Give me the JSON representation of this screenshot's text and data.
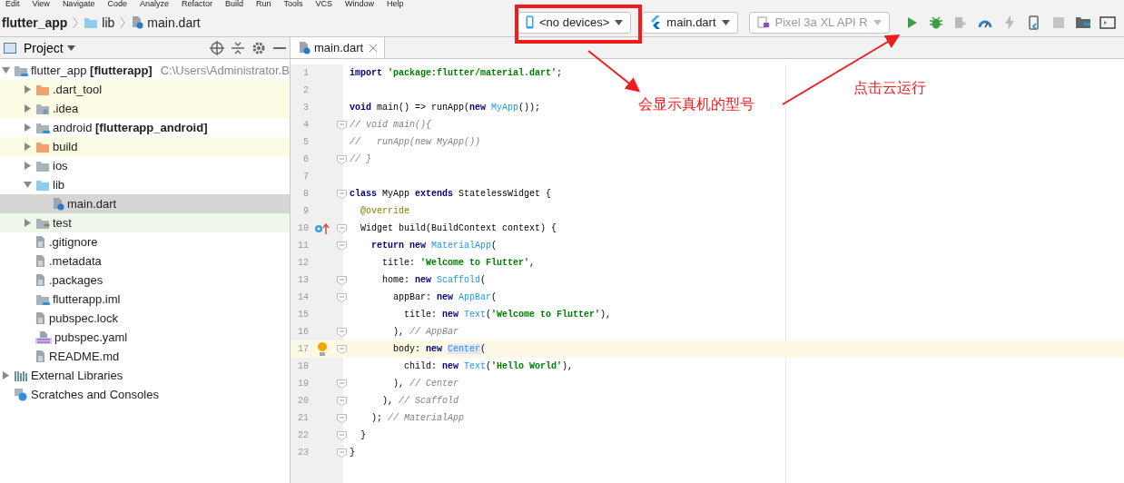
{
  "menu": [
    "Edit",
    "View",
    "Navigate",
    "Code",
    "Analyze",
    "Refactor",
    "Build",
    "Run",
    "Tools",
    "VCS",
    "Window",
    "Help"
  ],
  "breadcrumbs": [
    {
      "label": "flutter_app",
      "kind": "project"
    },
    {
      "label": "lib",
      "kind": "folder"
    },
    {
      "label": "main.dart",
      "kind": "dart"
    }
  ],
  "device_selector": {
    "label": "<no devices>"
  },
  "run_config": {
    "label": "main.dart"
  },
  "emulator_selector": {
    "label": "Pixel 3a XL API R",
    "disabled": true
  },
  "toolbar_icons": [
    {
      "kind": "run",
      "disabled": false
    },
    {
      "kind": "debug",
      "disabled": false
    },
    {
      "kind": "attach",
      "disabled": true
    },
    {
      "kind": "profile",
      "disabled": false
    },
    {
      "kind": "reload",
      "disabled": true
    },
    {
      "kind": "device",
      "disabled": false
    },
    {
      "kind": "stop",
      "disabled": true
    },
    {
      "kind": "structure",
      "disabled": false
    },
    {
      "kind": "terminal",
      "disabled": false
    }
  ],
  "project_panel": {
    "title": "Project",
    "tree": [
      {
        "label": "flutter_app **[flutterapp]**",
        "path": "C:\\Users\\Administrator.B",
        "kind": "module",
        "expanded": true,
        "selected": false,
        "children": [
          {
            "label": ".dart_tool",
            "kind": "folder-orange",
            "expanded": false,
            "selected": false,
            "excluded": true,
            "test": false
          },
          {
            "label": ".idea",
            "kind": "folder-gear",
            "expanded": false,
            "selected": false,
            "excluded": true,
            "test": false
          },
          {
            "label": "android **[flutterapp_android]**",
            "kind": "module",
            "expanded": false,
            "selected": false,
            "excluded": false,
            "test": false
          },
          {
            "label": "build",
            "kind": "folder-orange",
            "expanded": false,
            "selected": false,
            "excluded": true,
            "test": false
          },
          {
            "label": "ios",
            "kind": "folder-gray",
            "expanded": false,
            "selected": false,
            "excluded": false,
            "test": false
          },
          {
            "label": "lib",
            "kind": "folder",
            "expanded": true,
            "selected": false,
            "excluded": false,
            "test": false,
            "children": [
              {
                "label": "main.dart",
                "kind": "dart",
                "selected": true
              }
            ]
          },
          {
            "label": "test",
            "kind": "folder-test",
            "expanded": false,
            "selected": false,
            "excluded": false,
            "test": true
          },
          {
            "label": ".gitignore",
            "kind": "file",
            "selected": false,
            "excluded": false,
            "test": false
          },
          {
            "label": ".metadata",
            "kind": "file",
            "selected": false,
            "excluded": false,
            "test": false
          },
          {
            "label": ".packages",
            "kind": "file",
            "selected": false,
            "excluded": false,
            "test": false
          },
          {
            "label": "flutterapp.iml",
            "kind": "module",
            "selected": false,
            "excluded": false,
            "test": false
          },
          {
            "label": "pubspec.lock",
            "kind": "file",
            "selected": false,
            "excluded": false,
            "test": false
          },
          {
            "label": "pubspec.yaml",
            "kind": "yaml",
            "selected": false,
            "excluded": false,
            "test": false
          },
          {
            "label": "README.md",
            "kind": "file",
            "selected": false,
            "excluded": false,
            "test": false
          }
        ]
      },
      {
        "label": "External Libraries",
        "kind": "libraries",
        "expanded": false,
        "selected": false
      },
      {
        "label": "Scratches and Consoles",
        "kind": "scratches",
        "selected": false
      }
    ]
  },
  "editor": {
    "tabs": [
      {
        "label": "main.dart",
        "selected": true
      }
    ],
    "lines": [
      {
        "number": "1",
        "kind": "plain",
        "fold": false,
        "current": false,
        "tokens": [
          {
            "kind": "kw",
            "text": "import"
          },
          {
            "kind": "str",
            "text": " 'package:flutter/material.dart'"
          },
          {
            "kind": "plain",
            "text": ";"
          }
        ]
      },
      {
        "number": "2",
        "kind": "plain",
        "fold": false,
        "current": false
      },
      {
        "number": "3",
        "kind": "plain",
        "fold": false,
        "current": false,
        "tokens": [
          {
            "kind": "kw",
            "text": "void"
          },
          {
            "kind": "plain",
            "text": " main() => runApp("
          },
          {
            "kind": "kw",
            "text": "new "
          },
          {
            "kind": "cls",
            "text": "MyApp"
          },
          {
            "kind": "plain",
            "text": "());"
          }
        ]
      },
      {
        "number": "4",
        "kind": "plain",
        "fold": true,
        "current": false,
        "tokens": [
          {
            "kind": "cmt",
            "text": "// void main(){"
          }
        ]
      },
      {
        "number": "5",
        "kind": "plain",
        "fold": false,
        "current": false,
        "tokens": [
          {
            "kind": "cmt",
            "text": "//   runApp(new MyApp())"
          }
        ]
      },
      {
        "number": "6",
        "kind": "plain",
        "fold": true,
        "current": false,
        "tokens": [
          {
            "kind": "cmt",
            "text": "// }"
          }
        ]
      },
      {
        "number": "7",
        "kind": "plain",
        "fold": false,
        "current": false
      },
      {
        "number": "8",
        "kind": "plain",
        "fold": true,
        "current": false,
        "tokens": [
          {
            "kind": "kw",
            "text": "class"
          },
          {
            "kind": "plain",
            "text": " MyApp "
          },
          {
            "kind": "kw",
            "text": "extends"
          },
          {
            "kind": "plain",
            "text": " StatelessWidget {"
          }
        ]
      },
      {
        "number": "9",
        "kind": "plain",
        "fold": false,
        "current": false,
        "tokens": [
          {
            "kind": "ann",
            "text": "  @override"
          }
        ]
      },
      {
        "number": "10",
        "kind": "override",
        "fold": true,
        "current": false,
        "tokens": [
          {
            "kind": "plain",
            "text": "  Widget build(BuildContext context) {"
          }
        ]
      },
      {
        "number": "11",
        "kind": "plain",
        "fold": true,
        "current": false,
        "tokens": [
          {
            "kind": "kw",
            "text": "    return new "
          },
          {
            "kind": "cls",
            "text": "MaterialApp"
          },
          {
            "kind": "plain",
            "text": "("
          }
        ]
      },
      {
        "number": "12",
        "kind": "plain",
        "fold": false,
        "current": false,
        "tokens": [
          {
            "kind": "plain",
            "text": "      title: "
          },
          {
            "kind": "str",
            "text": "'Welcome to Flutter'"
          },
          {
            "kind": "plain",
            "text": ","
          }
        ]
      },
      {
        "number": "13",
        "kind": "plain",
        "fold": true,
        "current": false,
        "tokens": [
          {
            "kind": "plain",
            "text": "      home: "
          },
          {
            "kind": "kw",
            "text": "new "
          },
          {
            "kind": "cls",
            "text": "Scaffold"
          },
          {
            "kind": "plain",
            "text": "("
          }
        ]
      },
      {
        "number": "14",
        "kind": "plain",
        "fold": true,
        "current": false,
        "tokens": [
          {
            "kind": "plain",
            "text": "        appBar: "
          },
          {
            "kind": "kw",
            "text": "new "
          },
          {
            "kind": "cls",
            "text": "AppBar"
          },
          {
            "kind": "plain",
            "text": "("
          }
        ]
      },
      {
        "number": "15",
        "kind": "plain",
        "fold": false,
        "current": false,
        "tokens": [
          {
            "kind": "plain",
            "text": "          title: "
          },
          {
            "kind": "kw",
            "text": "new "
          },
          {
            "kind": "cls",
            "text": "Text"
          },
          {
            "kind": "plain",
            "text": "("
          },
          {
            "kind": "str",
            "text": "'Welcome to Flutter'"
          },
          {
            "kind": "plain",
            "text": "),"
          }
        ]
      },
      {
        "number": "16",
        "kind": "plain",
        "fold": true,
        "current": false,
        "tokens": [
          {
            "kind": "plain",
            "text": "        ), "
          },
          {
            "kind": "cmt",
            "text": "// AppBar"
          }
        ]
      },
      {
        "number": "17",
        "kind": "bulb",
        "fold": true,
        "current": true,
        "tokens": [
          {
            "kind": "plain",
            "text": "        body: "
          },
          {
            "kind": "kw",
            "text": "new "
          },
          {
            "kind": "cls-hl",
            "text": "Center"
          },
          {
            "kind": "plain",
            "text": "("
          }
        ]
      },
      {
        "number": "18",
        "kind": "plain",
        "fold": false,
        "current": false,
        "tokens": [
          {
            "kind": "plain",
            "text": "          child: "
          },
          {
            "kind": "kw",
            "text": "new "
          },
          {
            "kind": "cls",
            "text": "Text"
          },
          {
            "kind": "plain",
            "text": "("
          },
          {
            "kind": "str",
            "text": "'Hello World'"
          },
          {
            "kind": "plain",
            "text": "),"
          }
        ]
      },
      {
        "number": "19",
        "kind": "plain",
        "fold": true,
        "current": false,
        "tokens": [
          {
            "kind": "plain",
            "text": "        ), "
          },
          {
            "kind": "cmt",
            "text": "// Center"
          }
        ]
      },
      {
        "number": "20",
        "kind": "plain",
        "fold": true,
        "current": false,
        "tokens": [
          {
            "kind": "plain",
            "text": "      ), "
          },
          {
            "kind": "cmt",
            "text": "// Scaffold"
          }
        ]
      },
      {
        "number": "21",
        "kind": "plain",
        "fold": true,
        "current": false,
        "tokens": [
          {
            "kind": "plain",
            "text": "    ); "
          },
          {
            "kind": "cmt",
            "text": "// MaterialApp"
          }
        ]
      },
      {
        "number": "22",
        "kind": "plain",
        "fold": true,
        "current": false,
        "tokens": [
          {
            "kind": "plain",
            "text": "  }"
          }
        ]
      },
      {
        "number": "23",
        "kind": "plain",
        "fold": true,
        "current": false,
        "tokens": [
          {
            "kind": "plain",
            "text": "}"
          }
        ]
      }
    ]
  },
  "annotations": [
    {
      "text": "会显示真机的型号"
    },
    {
      "text": "点击云运行"
    }
  ]
}
